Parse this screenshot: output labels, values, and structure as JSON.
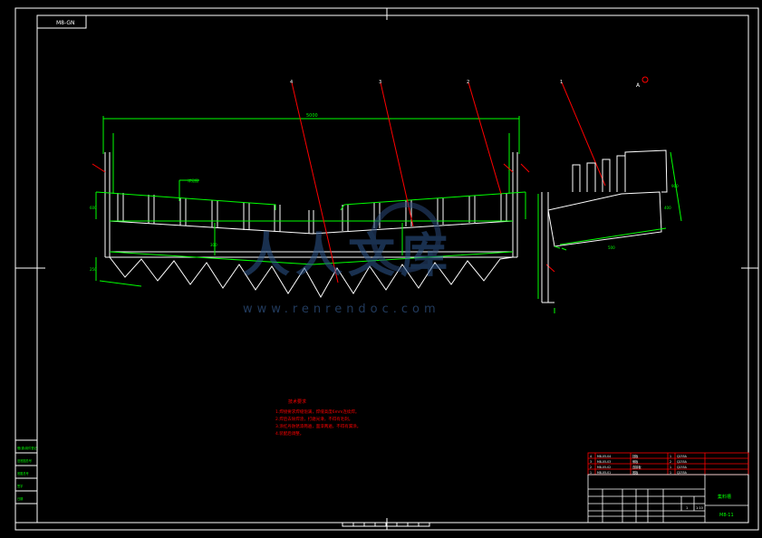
{
  "drawing_code": "M8-GN",
  "balloons": [
    "4",
    "3",
    "2",
    "1"
  ],
  "section_mark": "A",
  "overall_dim": "5000",
  "dims_left": [
    "600",
    "250",
    "300"
  ],
  "dims_right": [
    "900",
    "400",
    "500"
  ],
  "label_callout": "详见图",
  "notes": {
    "title": "技术要求",
    "items": [
      "1.焊接要求焊缝饱满，焊缝高度6mm连续焊。",
      "2.焊后去除焊渣，打磨光滑，不得有毛刺。",
      "3.涂红丹防锈漆两遍，面漆两遍，不得有漏涂。",
      "4.装配后调整。"
    ]
  },
  "bom": [
    {
      "no": "4",
      "code": "M8-05-04",
      "name": "挡板",
      "qty": "1",
      "mat": "Q235A"
    },
    {
      "no": "3",
      "code": "M8-05-03",
      "name": "侧板",
      "qty": "2",
      "mat": "Q235A"
    },
    {
      "no": "2",
      "code": "M8-05-02",
      "name": "连接板",
      "qty": "1",
      "mat": "Q235A"
    },
    {
      "no": "1",
      "code": "M8-05-01",
      "name": "底板",
      "qty": "1",
      "mat": "Q235A"
    }
  ],
  "title_block": {
    "part_name": "集料槽",
    "drawing_no": "M8-11",
    "scale": "1:10",
    "sheet": "1"
  },
  "left_column": [
    "借(通)用件登记",
    "旧底图总号",
    "底图总号",
    "签字",
    "日期"
  ],
  "watermark_url": "www.renrendoc.com",
  "watermark_glyphs": "人人文库"
}
